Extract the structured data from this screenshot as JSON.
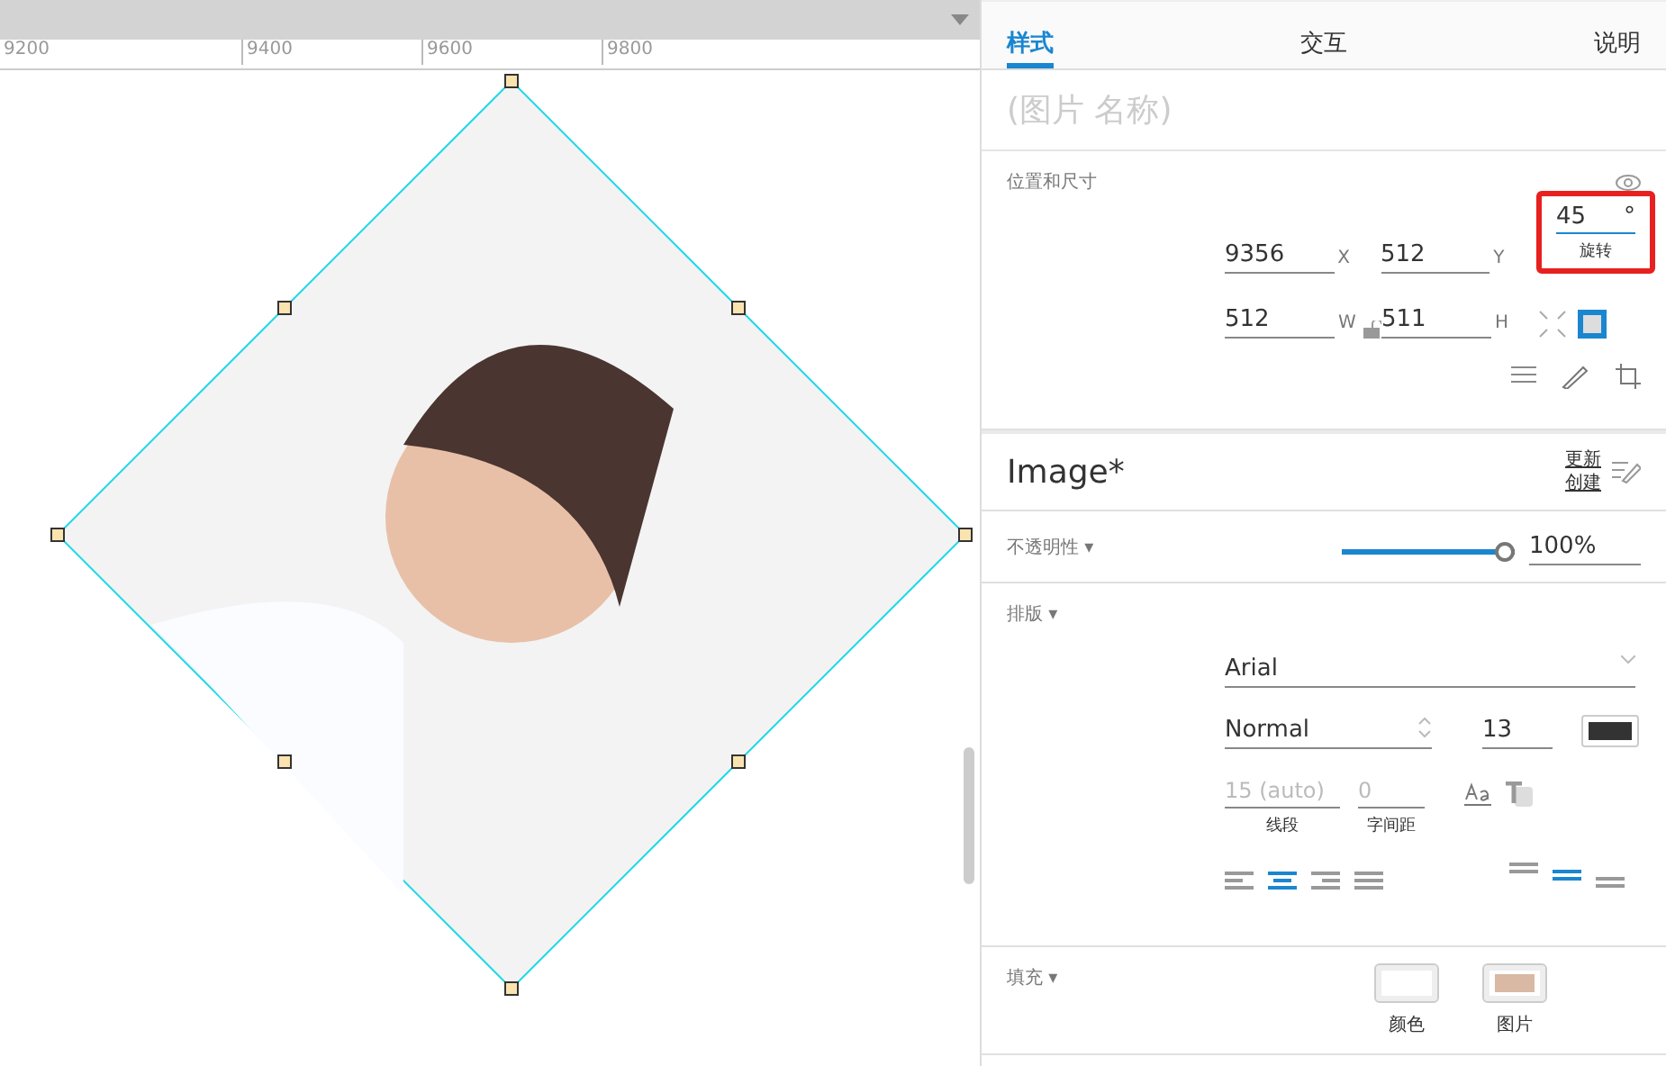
{
  "ruler": {
    "ticks": [
      "9200",
      "9400",
      "9600",
      "9800"
    ]
  },
  "tabs": [
    {
      "label": "样式",
      "selected": true
    },
    {
      "label": "交互",
      "selected": false
    },
    {
      "label": "说明",
      "selected": false
    }
  ],
  "name_field": {
    "placeholder": "(图片 名称)"
  },
  "position_size": {
    "title": "位置和尺寸",
    "row_1": [
      {
        "value": "9356",
        "unit": "X"
      },
      {
        "value": "512",
        "unit": "Y"
      }
    ],
    "rotation": {
      "value": "45",
      "unit": "°",
      "label": "旋转",
      "highlighted": true
    },
    "row_2": [
      {
        "value": "512",
        "unit": "W"
      },
      {
        "value": "511",
        "unit": "H"
      }
    ],
    "locked": false
  },
  "style": {
    "name": "Image*",
    "links": [
      "更新",
      "创建"
    ]
  },
  "opacity": {
    "label": "不透明性 ▾",
    "level": 1,
    "reading": "100%"
  },
  "typography": {
    "label": "排版 ▾",
    "font": "Arial",
    "weight": "Normal",
    "size": "13",
    "color": "#333333",
    "spacing": [
      {
        "placeholder": "15 (auto)",
        "label": "线段"
      },
      {
        "placeholder": "0",
        "label": "字间距"
      }
    ],
    "h_align": [
      {
        "kind": "left",
        "selected": false
      },
      {
        "kind": "center",
        "selected": true
      },
      {
        "kind": "right",
        "selected": false
      },
      {
        "kind": "justify",
        "selected": false
      }
    ],
    "v_align": [
      {
        "kind": "top",
        "selected": false
      },
      {
        "kind": "middle",
        "selected": true
      },
      {
        "kind": "bottom",
        "selected": false
      }
    ]
  },
  "fill": {
    "label": "填充 ▾",
    "options": [
      {
        "kind": "color",
        "label": "颜色"
      },
      {
        "kind": "image",
        "label": "图片"
      }
    ]
  }
}
